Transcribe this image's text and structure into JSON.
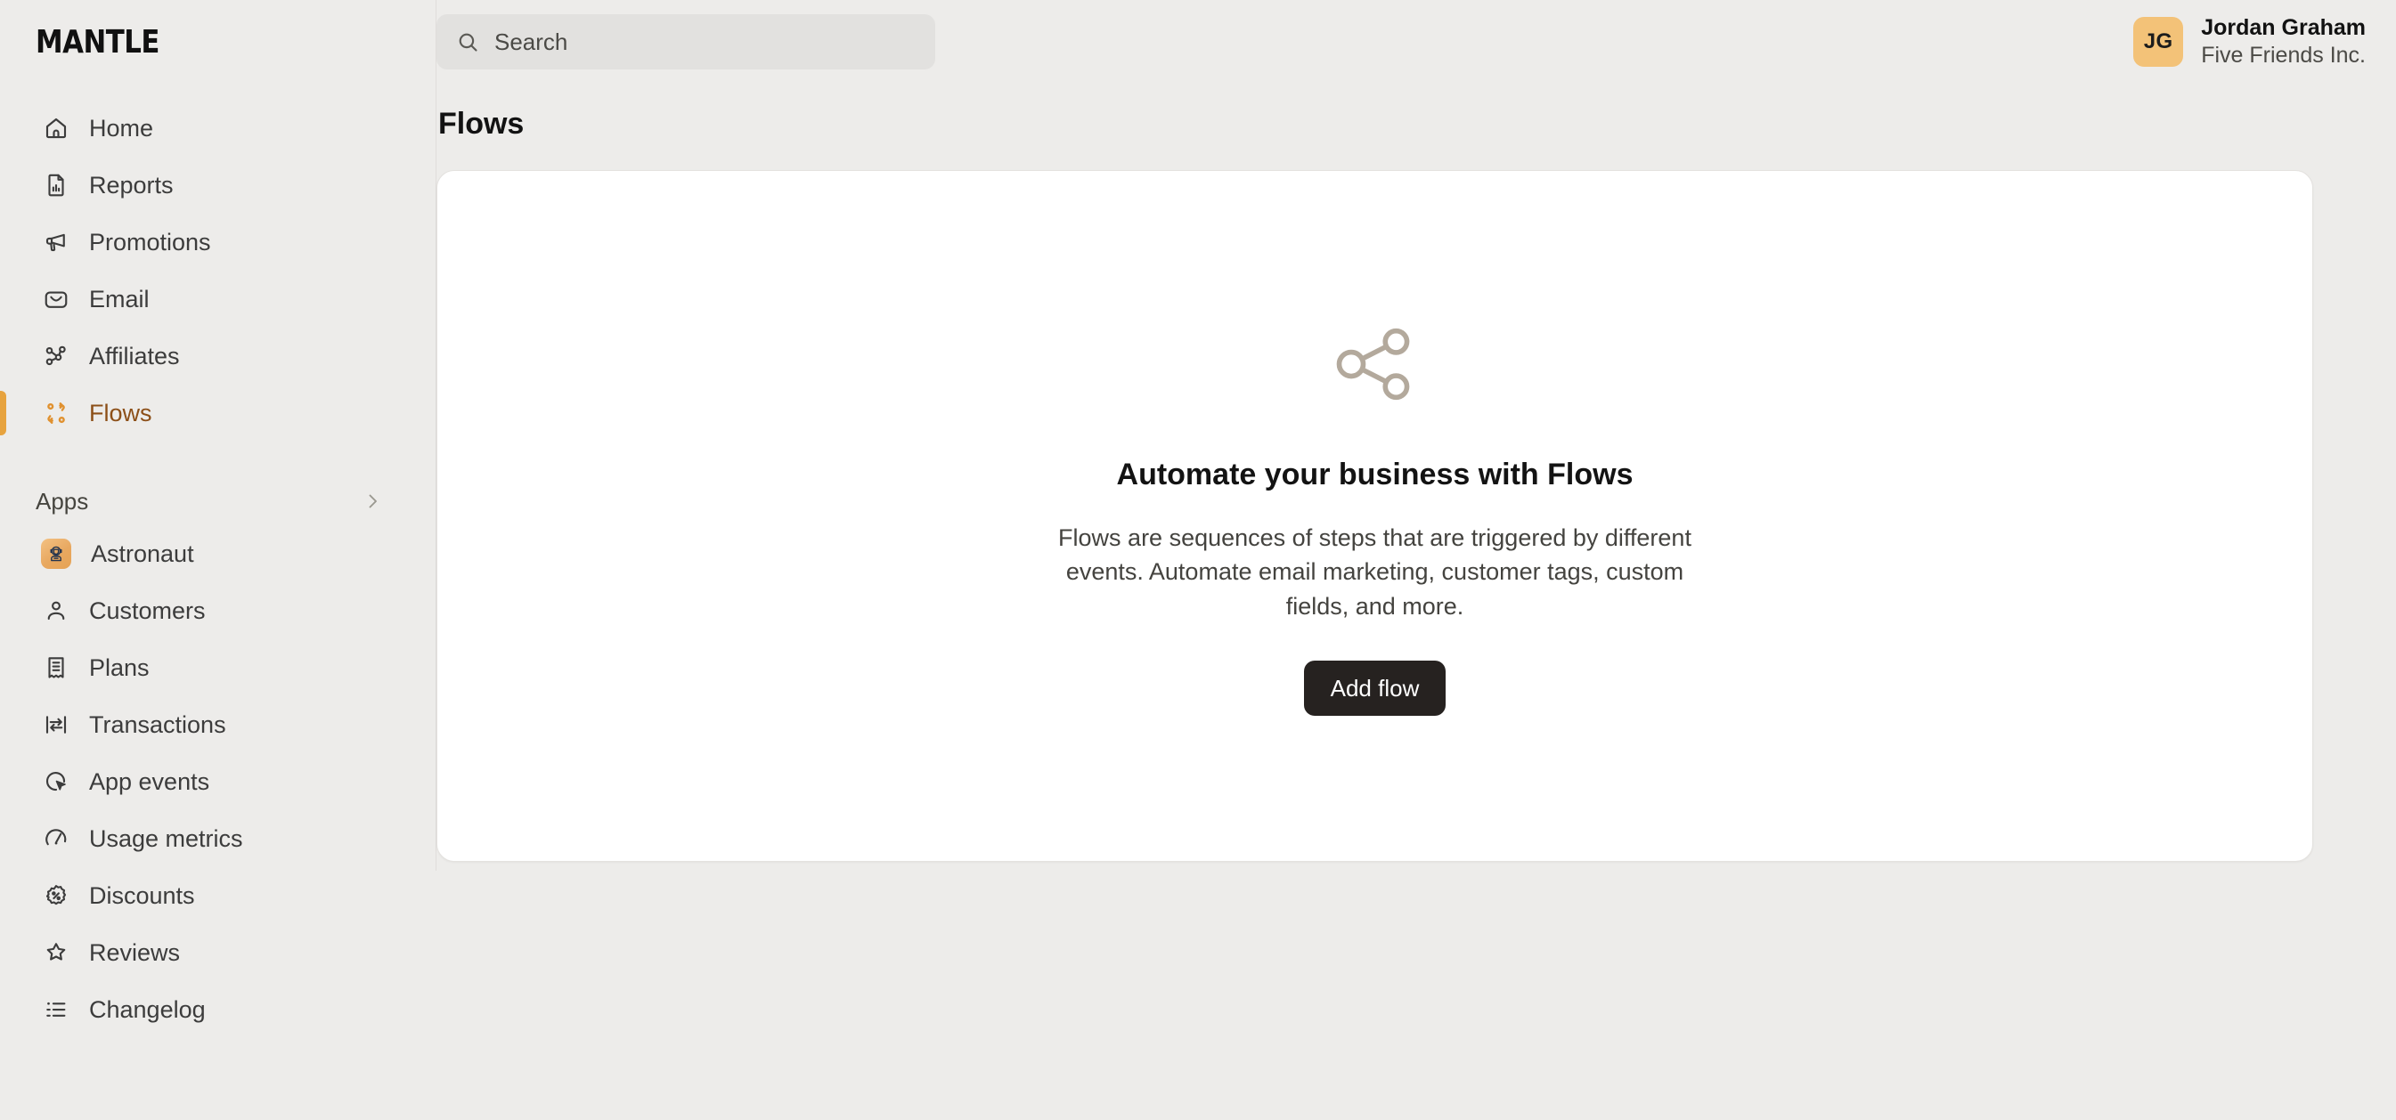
{
  "brand": {
    "wordmark": "MANTLE"
  },
  "search": {
    "placeholder": "Search",
    "value": "",
    "icon": "search-icon"
  },
  "user": {
    "initials": "JG",
    "name": "Jordan Graham",
    "org": "Five Friends Inc.",
    "avatar_color": "#f3c278"
  },
  "sidebar": {
    "primary_items": [
      {
        "label": "Home",
        "icon": "home-icon",
        "active": false
      },
      {
        "label": "Reports",
        "icon": "report-icon",
        "active": false
      },
      {
        "label": "Promotions",
        "icon": "megaphone-icon",
        "active": false
      },
      {
        "label": "Email",
        "icon": "envelope-icon",
        "active": false
      },
      {
        "label": "Affiliates",
        "icon": "affiliates-icon",
        "active": false
      },
      {
        "label": "Flows",
        "icon": "flow-icon",
        "active": true
      }
    ],
    "section": {
      "label": "Apps",
      "icon": "chevron-right-icon",
      "expanded": false
    },
    "app_items": [
      {
        "label": "Astronaut",
        "icon": "astronaut-app-icon",
        "app_tile": true
      },
      {
        "label": "Customers",
        "icon": "person-icon",
        "app_tile": false
      },
      {
        "label": "Plans",
        "icon": "receipt-icon",
        "app_tile": false
      },
      {
        "label": "Transactions",
        "icon": "transfer-icon",
        "app_tile": false
      },
      {
        "label": "App events",
        "icon": "cursor-click-icon",
        "app_tile": false
      },
      {
        "label": "Usage metrics",
        "icon": "gauge-icon",
        "app_tile": false
      },
      {
        "label": "Discounts",
        "icon": "discount-icon",
        "app_tile": false
      },
      {
        "label": "Reviews",
        "icon": "star-icon",
        "app_tile": false
      },
      {
        "label": "Changelog",
        "icon": "list-icon",
        "app_tile": false
      }
    ],
    "active_accent": "#e7a33e",
    "active_text": "#8c4f18"
  },
  "page": {
    "title": "Flows"
  },
  "empty_state": {
    "icon": "share-nodes-icon",
    "title": "Automate your business with Flows",
    "body": "Flows are sequences of steps that are triggered by different events. Automate email marketing, customer tags, custom fields, and more.",
    "cta_label": "Add flow"
  },
  "colors": {
    "background": "#edecea",
    "card": "#ffffff",
    "accent": "#e7a33e",
    "button": "#262220"
  }
}
